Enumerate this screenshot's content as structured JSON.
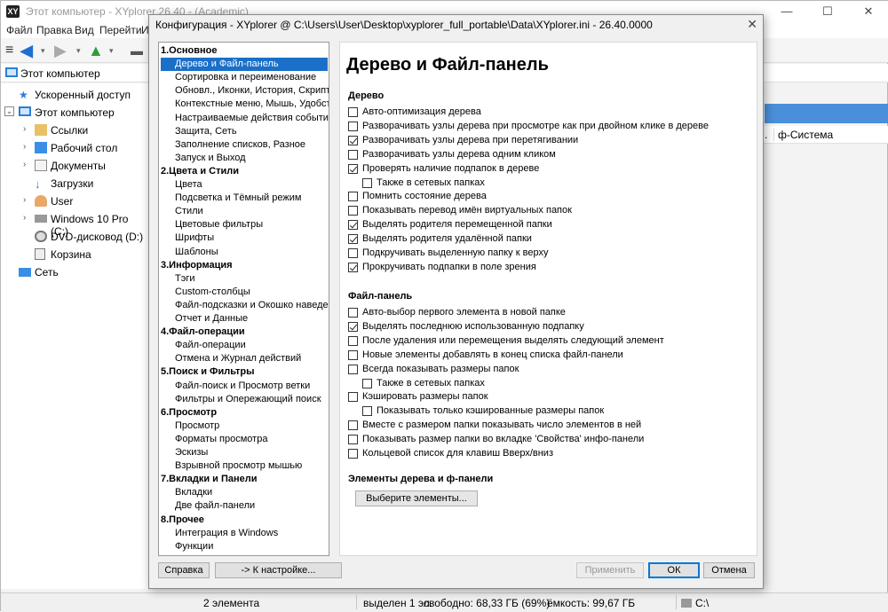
{
  "main_window": {
    "title": "Этот компьютер - XYplorer 26.40 - (Academic)",
    "controls": {
      "minimize": "—",
      "maximize": "☐",
      "close": "✕"
    },
    "menu": [
      "Файл",
      "Правка",
      "Вид",
      "Перейти",
      "И"
    ],
    "address": "Этот компьютер",
    "tree": [
      {
        "label": "Ускоренный доступ",
        "icon": "star-icon",
        "expander": ""
      },
      {
        "label": "Этот компьютер",
        "icon": "computer-icon",
        "expander": "⌄"
      },
      {
        "label": "Ссылки",
        "icon": "link-icon",
        "expander": "›"
      },
      {
        "label": "Рабочий стол",
        "icon": "desktop-icon",
        "expander": "›"
      },
      {
        "label": "Документы",
        "icon": "documents-icon",
        "expander": "›"
      },
      {
        "label": "Загрузки",
        "icon": "download-icon",
        "expander": ""
      },
      {
        "label": "User",
        "icon": "user-icon",
        "expander": "›"
      },
      {
        "label": "Windows 10 Pro (C:)",
        "icon": "drive-icon",
        "expander": "›"
      },
      {
        "label": "DVD-дисковод (D:)",
        "icon": "dvd-icon",
        "expander": ""
      },
      {
        "label": "Корзина",
        "icon": "recycle-bin-icon",
        "expander": ""
      },
      {
        "label": "Сеть",
        "icon": "network-icon",
        "expander": ""
      }
    ],
    "column_header_right": "ф-Система",
    "status": {
      "items": "2 элемента",
      "selected": "выделен 1 эл.",
      "free": "свободно: 68,33 ГБ (69%)",
      "capacity": "ёмкость: 99,67 ГБ",
      "drive": "C:\\"
    }
  },
  "dialog": {
    "title": "Конфигурация - XYplorer @ C:\\Users\\User\\Desktop\\xyplorer_full_portable\\Data\\XYplorer.ini - 26.40.0000",
    "close": "✕",
    "nav": [
      {
        "label": "1.Основное",
        "type": "cat"
      },
      {
        "label": "Дерево и Файл-панель",
        "type": "sel"
      },
      {
        "label": "Сортировка и переименование",
        "type": "sub"
      },
      {
        "label": "Обновл., Иконки, История, Скрипты",
        "type": "sub"
      },
      {
        "label": "Контекстные меню, Мышь, Удобства",
        "type": "sub"
      },
      {
        "label": "Настраиваемые действия событий",
        "type": "sub"
      },
      {
        "label": "Защита, Сеть",
        "type": "sub"
      },
      {
        "label": "Заполнение списков, Разное",
        "type": "sub"
      },
      {
        "label": "Запуск и Выход",
        "type": "sub"
      },
      {
        "label": "2.Цвета и Стили",
        "type": "cat"
      },
      {
        "label": "Цвета",
        "type": "sub"
      },
      {
        "label": "Подсветка и Тёмный режим",
        "type": "sub"
      },
      {
        "label": "Стили",
        "type": "sub"
      },
      {
        "label": "Цветовые фильтры",
        "type": "sub"
      },
      {
        "label": "Шрифты",
        "type": "sub"
      },
      {
        "label": "Шаблоны",
        "type": "sub"
      },
      {
        "label": "3.Информация",
        "type": "cat"
      },
      {
        "label": "Тэги",
        "type": "sub"
      },
      {
        "label": "Custom-столбцы",
        "type": "sub"
      },
      {
        "label": "Файл-подсказки и Окошко наведения",
        "type": "sub"
      },
      {
        "label": "Отчет и Данные",
        "type": "sub"
      },
      {
        "label": "4.Файл-операции",
        "type": "cat"
      },
      {
        "label": "Файл-операции",
        "type": "sub"
      },
      {
        "label": "Отмена и Журнал действий",
        "type": "sub"
      },
      {
        "label": "5.Поиск и Фильтры",
        "type": "cat"
      },
      {
        "label": "Файл-поиск и Просмотр ветки",
        "type": "sub"
      },
      {
        "label": "Фильтры и Опережающий поиск",
        "type": "sub"
      },
      {
        "label": "6.Просмотр",
        "type": "cat"
      },
      {
        "label": "Просмотр",
        "type": "sub"
      },
      {
        "label": "Форматы просмотра",
        "type": "sub"
      },
      {
        "label": "Эскизы",
        "type": "sub"
      },
      {
        "label": "Взрывной просмотр мышью",
        "type": "sub"
      },
      {
        "label": "7.Вкладки и Панели",
        "type": "cat"
      },
      {
        "label": "Вкладки",
        "type": "sub"
      },
      {
        "label": "Две файл-панели",
        "type": "sub"
      },
      {
        "label": "8.Прочее",
        "type": "cat"
      },
      {
        "label": "Интеграция в Windows",
        "type": "sub"
      },
      {
        "label": "Функции",
        "type": "sub"
      }
    ],
    "panel_title": "Дерево и Файл-панель",
    "group_tree": "Дерево",
    "tree_options": [
      {
        "label": "Авто-оптимизация дерева",
        "checked": false,
        "indent": 0
      },
      {
        "label": "Разворачивать узлы дерева при просмотре как при двойном клике в дереве",
        "checked": false,
        "indent": 0
      },
      {
        "label": "Разворачивать узлы дерева при перетягивании",
        "checked": true,
        "indent": 0
      },
      {
        "label": "Разворачивать узлы дерева одним кликом",
        "checked": false,
        "indent": 0
      },
      {
        "label": "Проверять наличие подпапок в дереве",
        "checked": true,
        "indent": 0
      },
      {
        "label": "Также в сетевых папках",
        "checked": false,
        "indent": 1
      },
      {
        "label": "Помнить состояние дерева",
        "checked": false,
        "indent": 0
      },
      {
        "label": "Показывать перевод имён виртуальных папок",
        "checked": false,
        "indent": 0
      },
      {
        "label": "Выделять родителя перемещенной папки",
        "checked": true,
        "indent": 0
      },
      {
        "label": "Выделять родителя удалённой папки",
        "checked": true,
        "indent": 0
      },
      {
        "label": "Подкручивать выделенную папку к верху",
        "checked": false,
        "indent": 0
      },
      {
        "label": "Прокручивать подпапки в поле зрения",
        "checked": true,
        "indent": 0
      }
    ],
    "group_filepanel": "Файл-панель",
    "filepanel_options": [
      {
        "label": "Авто-выбор первого элемента в новой папке",
        "checked": false,
        "indent": 0
      },
      {
        "label": "Выделять последнюю использованную подпапку",
        "checked": true,
        "indent": 0
      },
      {
        "label": "После удаления или перемещения выделять следующий элемент",
        "checked": false,
        "indent": 0
      },
      {
        "label": "Новые элементы добавлять в конец списка файл-панели",
        "checked": false,
        "indent": 0
      },
      {
        "label": "Всегда показывать размеры папок",
        "checked": false,
        "indent": 0
      },
      {
        "label": "Также в сетевых папках",
        "checked": false,
        "indent": 1
      },
      {
        "label": "Кэшировать размеры папок",
        "checked": false,
        "indent": 0
      },
      {
        "label": "Показывать только кэшированные размеры папок",
        "checked": false,
        "indent": 1
      },
      {
        "label": "Вместе с размером папки показывать число элементов в ней",
        "checked": false,
        "indent": 0
      },
      {
        "label": "Показывать размер папки во вкладке 'Свойства' инфо-панели",
        "checked": false,
        "indent": 0
      },
      {
        "label": "Кольцевой список для клавиш Вверх/вниз",
        "checked": false,
        "indent": 0
      }
    ],
    "group_elements": "Элементы дерева и ф-панели",
    "select_elements_button": "Выберите элементы...",
    "buttons": {
      "help": "Справка",
      "goto_setting": "-> К настройке...",
      "apply": "Применить",
      "ok": "ОК",
      "cancel": "Отмена"
    }
  }
}
